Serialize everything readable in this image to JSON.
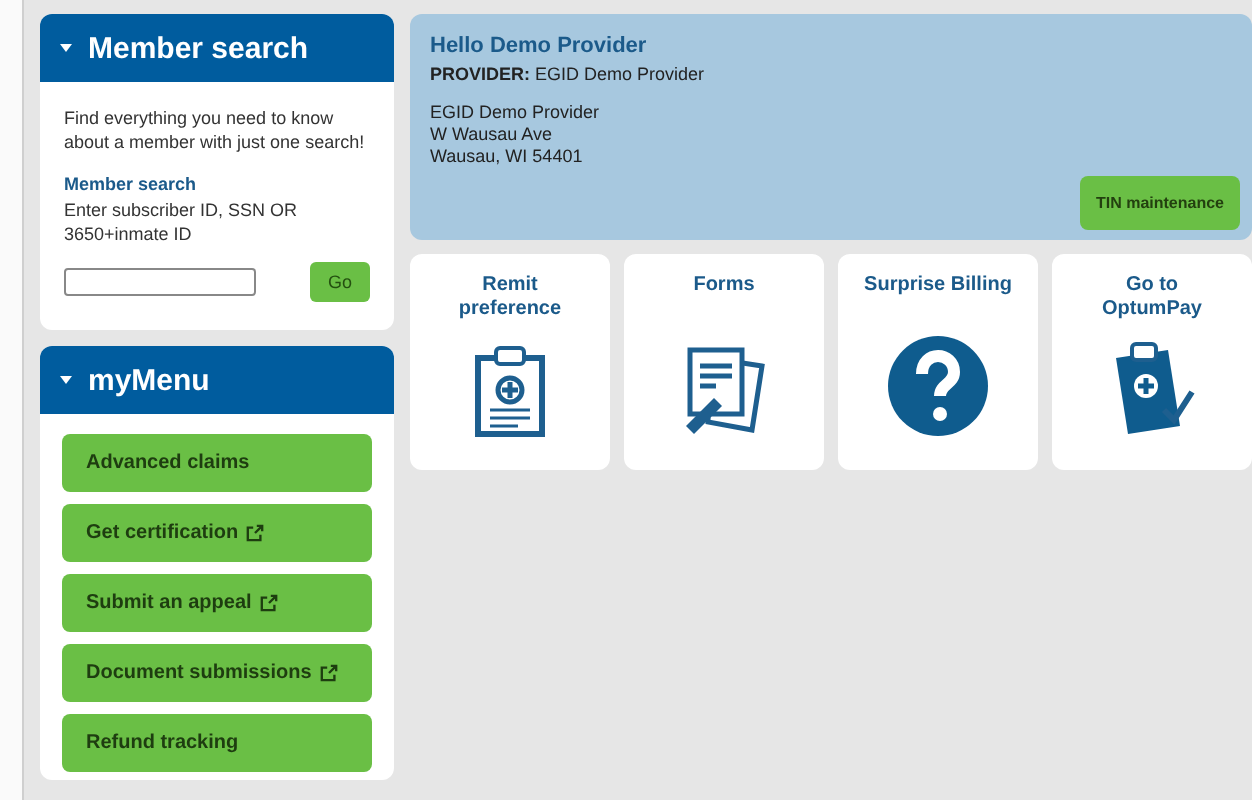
{
  "member_search": {
    "title": "Member search",
    "intro": "Find everything you need to know about a member with just one search!",
    "label": "Member search",
    "hint": "Enter subscriber ID, SSN OR 3650+inmate ID",
    "button": "Go"
  },
  "my_menu": {
    "title": "myMenu",
    "items": [
      {
        "label": "Advanced claims",
        "external": false
      },
      {
        "label": "Get certification",
        "external": true
      },
      {
        "label": "Submit an appeal",
        "external": true
      },
      {
        "label": "Document submissions",
        "external": true
      },
      {
        "label": "Refund tracking",
        "external": false
      }
    ]
  },
  "banner": {
    "greeting": "Hello Demo Provider",
    "provider_label": "PROVIDER:",
    "provider_name": "EGID Demo Provider",
    "address": [
      "EGID Demo Provider",
      "W Wausau Ave",
      "Wausau, WI 54401"
    ],
    "button": "TIN maintenance"
  },
  "tiles": [
    {
      "label": "Remit preference",
      "kind": "clipboard"
    },
    {
      "label": "Forms",
      "kind": "forms"
    },
    {
      "label": "Surprise Billing",
      "kind": "question"
    },
    {
      "label": "Go to OptumPay",
      "kind": "clipboard-check"
    }
  ]
}
